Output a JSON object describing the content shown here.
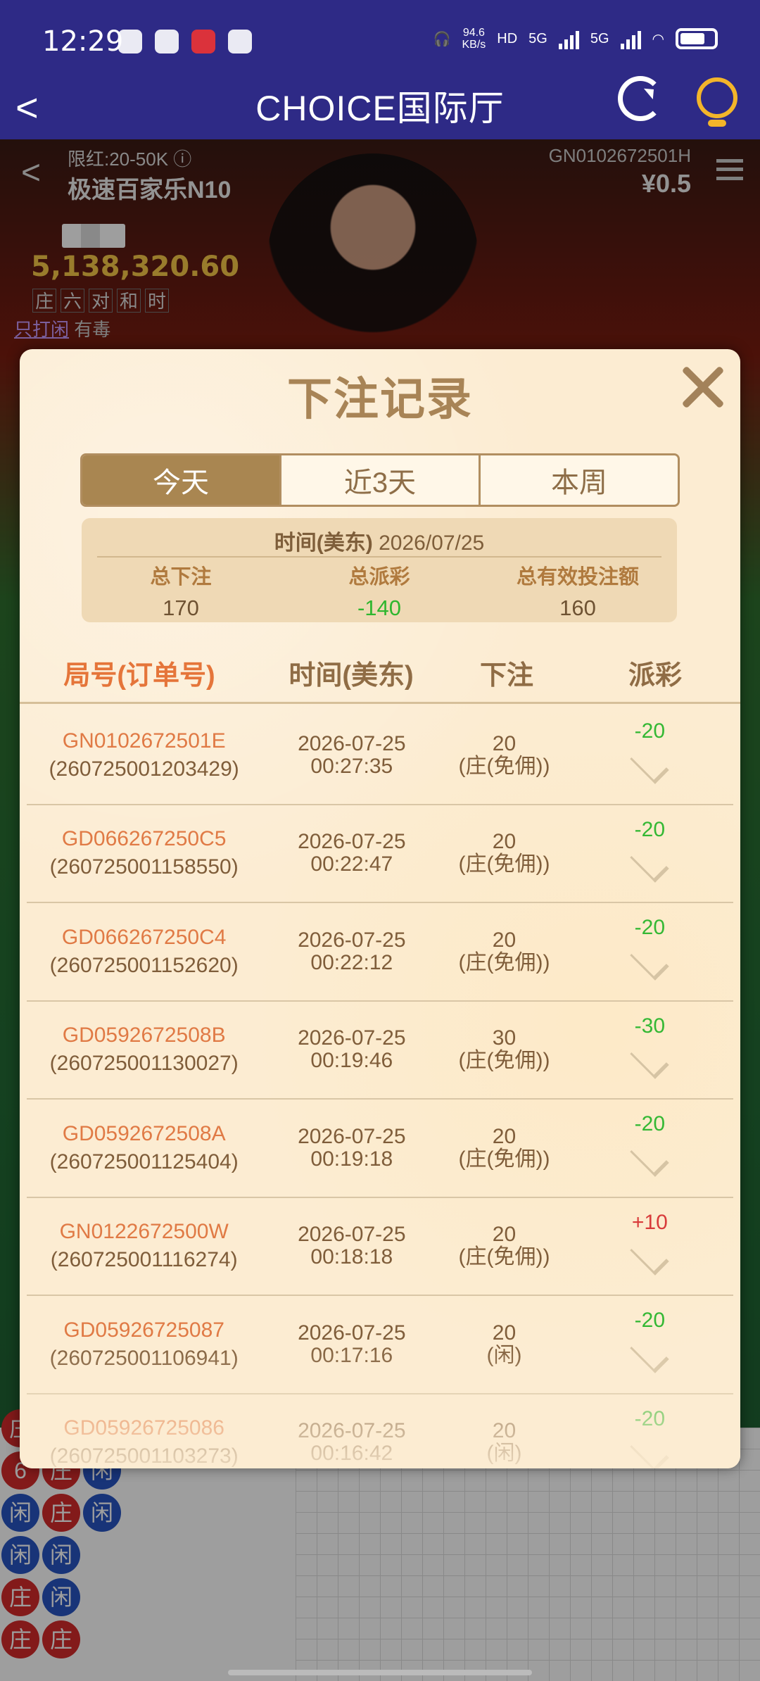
{
  "status_bar": {
    "time": "12:29",
    "net_speed": "94.6",
    "net_unit": "KB/s",
    "sim": "HD",
    "sig1": "5G",
    "sig2": "5G"
  },
  "nav": {
    "back": "<",
    "title": "CHOICE国际厅"
  },
  "game": {
    "back": "<",
    "limit": "限红:20-50K ⓘ",
    "table_name": "极速百家乐N10",
    "table_code": "GN0102672501H",
    "balance": "¥0.5",
    "pool": "5,138,320.60",
    "bet_types": [
      "庄",
      "六",
      "对",
      "和",
      "时"
    ],
    "warn_link": "只打闲",
    "warn_rest": "有毒",
    "roads": [
      [
        "庄",
        "b"
      ],
      [
        "6",
        "b"
      ],
      [
        "庄",
        "b"
      ],
      [
        "闲",
        "p"
      ],
      [
        "闲",
        "p"
      ],
      [
        "庄",
        "b"
      ],
      [
        "闲",
        "p"
      ],
      [
        "闲",
        "p"
      ],
      [
        "闲",
        "p"
      ],
      [
        "庄",
        "b"
      ],
      [
        "闲",
        "p"
      ],
      [
        "庄",
        "b"
      ],
      [
        "庄",
        "b"
      ]
    ]
  },
  "modal": {
    "title": "下注记录",
    "tabs": [
      {
        "label": "今天",
        "active": true
      },
      {
        "label": "近3天",
        "active": false
      },
      {
        "label": "本周",
        "active": false
      }
    ],
    "summary": {
      "date_label": "时间(美东)",
      "date_value": "2026/07/25",
      "total_bet_label": "总下注",
      "total_bet": "170",
      "total_payout_label": "总派彩",
      "total_payout": "-140",
      "total_valid_label": "总有效投注额",
      "total_valid": "160"
    },
    "columns": [
      "局号(订单号)",
      "时间(美东)",
      "下注",
      "派彩"
    ],
    "rows": [
      {
        "id": "GN0102672501E",
        "order": "(260725001203429)",
        "date": "2026-07-25",
        "time": "00:27:35",
        "amount": "20",
        "side": "(庄(免佣))",
        "payout": "-20",
        "win": false
      },
      {
        "id": "GD066267250C5",
        "order": "(260725001158550)",
        "date": "2026-07-25",
        "time": "00:22:47",
        "amount": "20",
        "side": "(庄(免佣))",
        "payout": "-20",
        "win": false
      },
      {
        "id": "GD066267250C4",
        "order": "(260725001152620)",
        "date": "2026-07-25",
        "time": "00:22:12",
        "amount": "20",
        "side": "(庄(免佣))",
        "payout": "-20",
        "win": false
      },
      {
        "id": "GD0592672508B",
        "order": "(260725001130027)",
        "date": "2026-07-25",
        "time": "00:19:46",
        "amount": "30",
        "side": "(庄(免佣))",
        "payout": "-30",
        "win": false
      },
      {
        "id": "GD0592672508A",
        "order": "(260725001125404)",
        "date": "2026-07-25",
        "time": "00:19:18",
        "amount": "20",
        "side": "(庄(免佣))",
        "payout": "-20",
        "win": false
      },
      {
        "id": "GN0122672500W",
        "order": "(260725001116274)",
        "date": "2026-07-25",
        "time": "00:18:18",
        "amount": "20",
        "side": "(庄(免佣))",
        "payout": "+10",
        "win": true
      },
      {
        "id": "GD05926725087",
        "order": "(260725001106941)",
        "date": "2026-07-25",
        "time": "00:17:16",
        "amount": "20",
        "side": "(闲)",
        "payout": "-20",
        "win": false
      },
      {
        "id": "GD05926725086",
        "order": "(260725001103273)",
        "date": "2026-07-25",
        "time": "00:16:42",
        "amount": "20",
        "side": "(闲)",
        "payout": "-20",
        "win": false
      }
    ]
  },
  "colors": {
    "header_bg": "#2e2a86",
    "accent": "#a98651",
    "loss": "#34b834",
    "win": "#d83b3b",
    "order_id": "#e07a45"
  }
}
